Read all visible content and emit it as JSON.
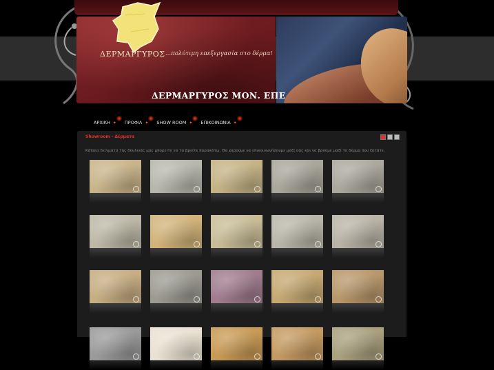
{
  "brand": {
    "logo_text": "ΔΕΡΜΑΡΓΥΡΟΣ",
    "tagline": "...πολύτιμη επεξεργασία στο δέρμα!",
    "company_name": "ΔΕΡΜΑΡΓΥΡΟΣ ΜΟΝ. ΕΠΕ"
  },
  "nav": {
    "items": [
      {
        "label": "ΑΡΧΙΚΗ"
      },
      {
        "label": "ΠΡΟΦΙΛ"
      },
      {
        "label": "SHOW ROOM"
      },
      {
        "label": "ΕΠΙΚΟΙΝΩΝΙΑ"
      }
    ]
  },
  "content": {
    "breadcrumb": "Showroom - Δέρματα",
    "description": "Κάποια δείγματα της δουλειάς μας μπορείτε να τα βρείτε παρακάτω. Θα χαρούμε να επικοινωνήσουμε μαζί σας και να βρούμε μαζί το δέρμα που ζητάτε."
  },
  "colors": {
    "accent_red": "#e0312a",
    "nav_star": "#ff5a3c",
    "panel_bg": "#1c1c1c"
  },
  "gallery": {
    "rows": [
      [
        "#c9b48a",
        "#b8b7ae",
        "#c4b385",
        "#a9a69a",
        "#aca89e"
      ],
      [
        "#bdb8a6",
        "#d1b37a",
        "#c8bd97",
        "#b9b6a9",
        "#b9b4a6"
      ],
      [
        "#c6ad82",
        "#9c9a92",
        "#a07c8e",
        "#c6a872",
        "#b8976a"
      ],
      [
        "#9a9a9a",
        "#e9e2d2",
        "#c89a55",
        "#c49a62",
        "#a9a07e"
      ]
    ]
  }
}
